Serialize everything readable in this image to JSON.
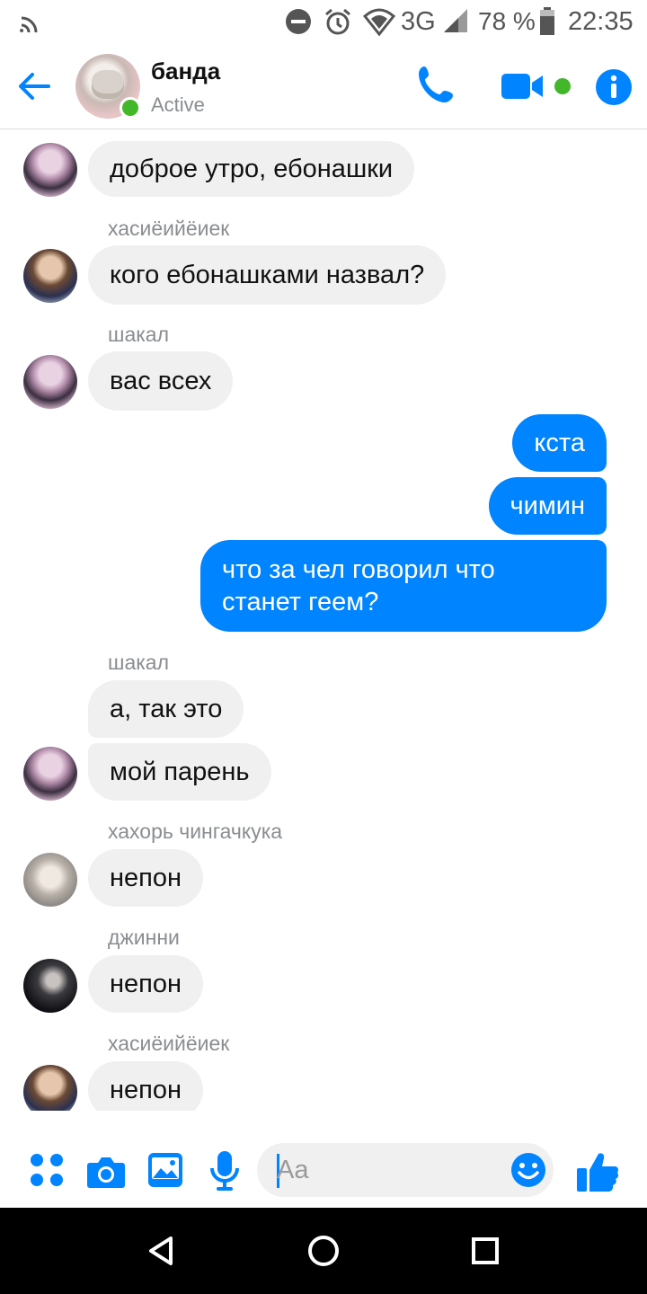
{
  "status_bar": {
    "network": "3G",
    "battery": "78 %",
    "time": "22:35",
    "icons": [
      "cast-icon",
      "dnd-icon",
      "alarm-icon",
      "wifi-icon",
      "signal-icon",
      "battery-icon"
    ]
  },
  "header": {
    "title": "банда",
    "subtitle": "Active",
    "accent_color": "#0084ff",
    "active_color": "#42b72a"
  },
  "messages": [
    {
      "direction": "in",
      "sender": "",
      "text": "доброе утро, ебонашки",
      "avatar": "avatar-pink"
    },
    {
      "direction": "in",
      "sender": "хасиёийёиек",
      "text": "кого ебонашками назвал?",
      "avatar": "avatar-brown"
    },
    {
      "direction": "in",
      "sender": "шакал",
      "text": "вас всех",
      "avatar": "avatar-pink"
    },
    {
      "direction": "out",
      "text": "кста"
    },
    {
      "direction": "out",
      "text": "чимин"
    },
    {
      "direction": "out",
      "text_lines": [
        "что за чел говорил что",
        "станет геем?"
      ]
    },
    {
      "direction": "in",
      "sender": "шакал",
      "text": "а, так это",
      "avatar": ""
    },
    {
      "direction": "in",
      "sender": "",
      "text": "мой парень",
      "avatar": "avatar-pink"
    },
    {
      "direction": "in",
      "sender": "хахорь чингачкука",
      "text": "непон",
      "avatar": "avatar-grey"
    },
    {
      "direction": "in",
      "sender": "джинни",
      "text": "непон",
      "avatar": "avatar-dark"
    },
    {
      "direction": "in",
      "sender": "хасиёийёиек",
      "text": "непон",
      "avatar": "avatar-brown"
    }
  ],
  "composer": {
    "placeholder": "Aa",
    "value": ""
  }
}
